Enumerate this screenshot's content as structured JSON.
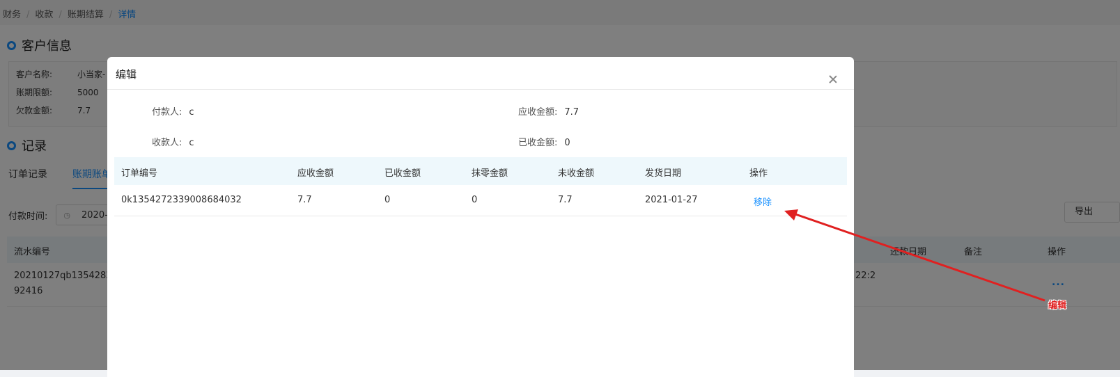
{
  "breadcrumb": [
    "财务",
    "收款",
    "账期结算",
    "详情"
  ],
  "customer_section": {
    "title": "客户信息",
    "rows": [
      {
        "label": "客户名称:",
        "value": "小当家-"
      },
      {
        "label": "账期限额:",
        "value": "5000"
      },
      {
        "label": "欠款金额:",
        "value": "7.7"
      }
    ]
  },
  "record_section": {
    "title": "记录",
    "tabs": [
      "订单记录",
      "账期账单"
    ],
    "filter_label": "付款时间:",
    "filter_date": "2020-",
    "export_label": "导出",
    "table_headers": {
      "serial": "流水编号",
      "repay_date": "还款日期",
      "remark": "备注",
      "action": "操作"
    },
    "row": {
      "serial_line1": "20210127qb13542835",
      "serial_line2": "92416",
      "time_fragment": "22:2",
      "more": "..."
    }
  },
  "modal": {
    "title": "编辑",
    "payer_label": "付款人:",
    "payer_value": "c",
    "payee_label": "收款人:",
    "payee_value": "c",
    "receivable_label": "应收金额:",
    "receivable_value": "7.7",
    "received_label": "已收金额:",
    "received_value": "0",
    "table": {
      "headers": [
        "订单编号",
        "应收金额",
        "已收金额",
        "抹零金额",
        "未收金额",
        "发货日期",
        "操作"
      ],
      "rows": [
        {
          "order_no": "0k1354272339008684032",
          "receivable": "7.7",
          "received": "0",
          "rounding": "0",
          "unreceived": "7.7",
          "ship_date": "2021-01-27",
          "action": "移除"
        }
      ]
    }
  },
  "annotation": {
    "label": "编辑",
    "color": "#e02020"
  },
  "colors": {
    "accent": "#1890ff",
    "table_header_bg": "#eef8fc",
    "mask": "rgba(0,0,0,0.5)"
  }
}
